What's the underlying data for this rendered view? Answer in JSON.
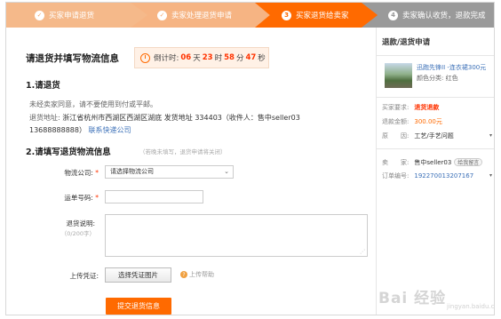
{
  "steps": [
    {
      "num": "✓",
      "label": "买家申请退货"
    },
    {
      "num": "✓",
      "label": "卖家处理退货申请"
    },
    {
      "num": "3",
      "label": "买家退货给卖家"
    },
    {
      "num": "4",
      "label": "卖家确认收货，退款完成"
    }
  ],
  "main": {
    "title": "请退货并填写物流信息",
    "countdown": {
      "prefix": "倒计时:",
      "days": "06",
      "days_unit": "天",
      "hours": "23",
      "hours_unit": "时",
      "minutes": "58",
      "minutes_unit": "分",
      "seconds": "47",
      "seconds_unit": "秒"
    },
    "section1": {
      "heading": "1.请退货",
      "note": "未经卖家同意，请不要使用到付或平邮。",
      "address_label": "退货地址:",
      "address_line1": "浙江省杭州市西湖区西湖区湖底 发货地址 334403（收件人：售中seller03",
      "address_line2": "13688888888）",
      "contact_link": "联系快递公司"
    },
    "section2": {
      "heading": "2.请填写退货物流信息",
      "hint": "（若晚未填写，退货申请将关闭）",
      "carrier_label": "物流公司:",
      "carrier_value": "请选择物流公司",
      "tracking_label": "运单号码:",
      "desc_label": "退货说明:",
      "desc_count": "（0/200字）",
      "upload_label": "上传凭证:",
      "upload_button": "选择凭证图片",
      "help": "上传帮助",
      "submit": "提交退货信息"
    }
  },
  "sidebar": {
    "title": "退款/退货申请",
    "product_name": "迅跑先锋II -连衣裙300元",
    "product_color": "颜色分类: 红色",
    "requirement_label": "买家要求:",
    "requirement_value": "退货退款",
    "amount_label": "退款金额:",
    "amount_value": "300.00元",
    "reason_label": "原　　因:",
    "reason_value": "工艺/手艺问题",
    "seller_label": "卖　　家:",
    "seller_value": "售中seller03",
    "wangwang": "给我留言",
    "order_label": "订单编号:",
    "order_value": "192270013207167"
  },
  "watermark": {
    "text": "Bai 经验",
    "sub": "jingyan.baidu.com"
  },
  "colors": {
    "accent": "#ff6a00",
    "link": "#3a6fb7",
    "done_step": "#f5b98a",
    "pending_step": "#9a9a9a"
  }
}
